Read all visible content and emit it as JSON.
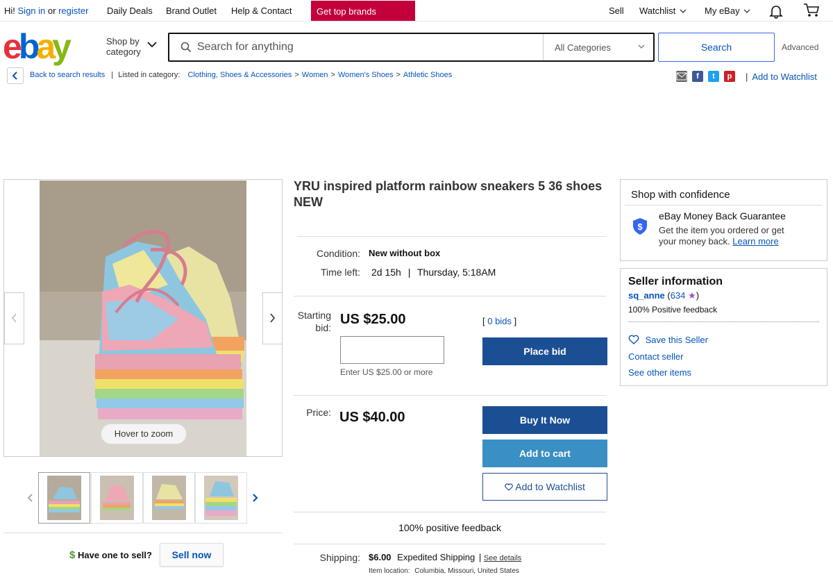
{
  "topnav": {
    "greeting": "Hi!",
    "sign_in": "Sign in",
    "or": "or",
    "register": "register",
    "links": [
      "Daily Deals",
      "Brand Outlet",
      "Help & Contact"
    ],
    "promo": "Get top brands",
    "sell": "Sell",
    "watchlist": "Watchlist",
    "my_ebay": "My eBay"
  },
  "header": {
    "shop_by_line1": "Shop by",
    "shop_by_line2": "category",
    "search_placeholder": "Search for anything",
    "category": "All Categories",
    "search_button": "Search",
    "advanced": "Advanced"
  },
  "breadcrumb": {
    "back": "Back to search results",
    "listed_in": "Listed in category:",
    "items": [
      "Clothing, Shoes & Accessories",
      "Women",
      "Women's Shoes",
      "Athletic Shoes"
    ],
    "add_to_watchlist": "Add to Watchlist"
  },
  "gallery": {
    "zoom": "Hover to zoom",
    "have_one": "Have one to sell?",
    "sell_now": "Sell now"
  },
  "item": {
    "title": "YRU inspired platform rainbow sneakers 5 36 shoes NEW",
    "condition_label": "Condition:",
    "condition": "New without box",
    "time_left_label": "Time left:",
    "time_left": "2d 15h",
    "time_end": "Thursday, 5:18AM",
    "starting_bid_line1": "Starting",
    "starting_bid_line2": "bid:",
    "starting_bid": "US $25.00",
    "bids": "0 bids",
    "bid_hint": "Enter US $25.00 or more",
    "place_bid": "Place bid",
    "price_label": "Price:",
    "price": "US $40.00",
    "buy_it_now": "Buy It Now",
    "add_to_cart": "Add to cart",
    "add_to_watchlist": "Add to Watchlist",
    "positive_feedback": "100% positive feedback",
    "shipping_label": "Shipping:",
    "shipping_cost": "$6.00",
    "shipping_method": "Expedited Shipping",
    "see_details": "See details",
    "item_location_label": "Item location:",
    "item_location": "Columbia, Missouri, United States"
  },
  "confidence": {
    "heading": "Shop with confidence",
    "guarantee_title": "eBay Money Back Guarantee",
    "guarantee_line1": "Get the item you ordered or get",
    "guarantee_line2": "your money back.",
    "learn_more": "Learn more"
  },
  "seller": {
    "heading": "Seller information",
    "name": "sq_anne",
    "score": "634",
    "feedback": "100% Positive feedback",
    "save": "Save this Seller",
    "contact": "Contact seller",
    "other_items": "See other items"
  },
  "colors": {
    "brand_red": "#e53238",
    "brand_blue": "#0064d2",
    "brand_yellow": "#f5af02",
    "brand_green": "#86b817",
    "promo": "#c4003b",
    "button_dark": "#1b4f94",
    "button_light": "#3a8fc3",
    "link": "#0654ba"
  }
}
